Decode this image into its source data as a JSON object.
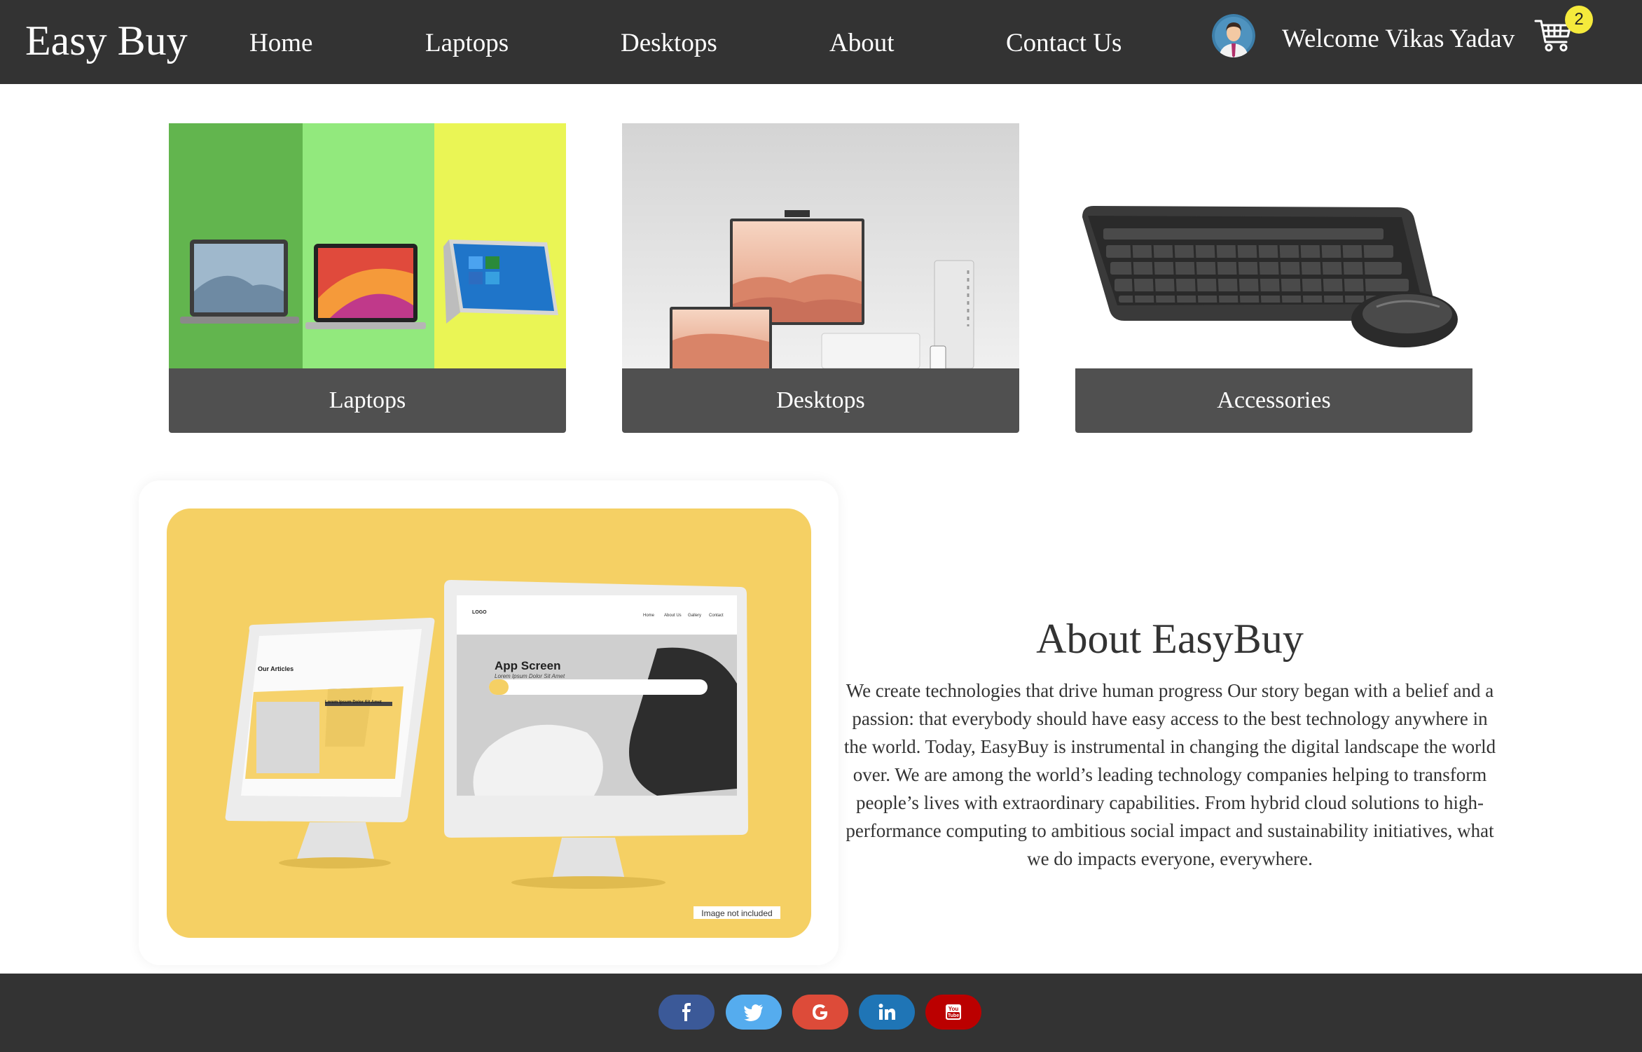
{
  "nav": {
    "brand": "Easy Buy",
    "links": [
      "Home",
      "Laptops",
      "Desktops",
      "About",
      "Contact Us"
    ],
    "welcome": "Welcome Vikas Yadav",
    "cart_count": "2",
    "icons": {
      "avatar": "user-avatar-icon",
      "cart": "shopping-cart-icon"
    }
  },
  "categories": [
    {
      "label": "Laptops",
      "image": "laptops-image"
    },
    {
      "label": "Desktops",
      "image": "desktops-image"
    },
    {
      "label": "Accessories",
      "image": "accessories-image"
    }
  ],
  "about": {
    "title": "About EasyBuy",
    "text": "We create technologies that drive human progress Our story began with a belief and a passion: that everybody should have easy access to the best technology anywhere in the world. Today, EasyBuy is instrumental in changing the digital landscape the world over. We are among the world’s leading technology companies helping to transform people’s lives with extraordinary capabilities. From hybrid cloud solutions to high-performance computing to ambitious social impact and sustainability initiatives, what we do impacts everyone, everywhere.",
    "mockup": {
      "app_title": "App Screen",
      "app_subtitle": "Lorem Ipsum Dolor Sit Amet",
      "logo": "LOGO",
      "menu": [
        "Home",
        "About Us",
        "Gallery",
        "Contact"
      ],
      "side_heading": "Our Articles",
      "card_title": "Lorem Ipsum Dolor Sit Amet",
      "caption": "Image not included"
    }
  },
  "footer": {
    "social": [
      {
        "name": "facebook",
        "color": "#3b5998"
      },
      {
        "name": "twitter",
        "color": "#55acee"
      },
      {
        "name": "google",
        "color": "#dd4b39"
      },
      {
        "name": "linkedin",
        "color": "#1f75b6"
      },
      {
        "name": "youtube",
        "color": "#bb0000"
      }
    ]
  },
  "colors": {
    "nav_bg": "#333333",
    "label_bg": "#505050",
    "about_bg": "#f5d064",
    "badge": "#f5ea3c"
  }
}
